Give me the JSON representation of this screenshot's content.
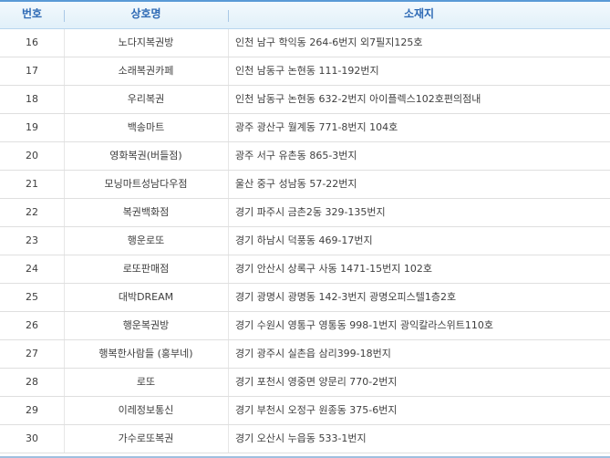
{
  "header": {
    "col_no": "번호",
    "col_name": "상호명",
    "col_addr": "소재지"
  },
  "rows": [
    {
      "no": "16",
      "name": "노다지복권방",
      "addr": "인천 남구 학익동 264-6번지 외7필지125호"
    },
    {
      "no": "17",
      "name": "소래복권카페",
      "addr": "인천 남동구 논현동 111-192번지"
    },
    {
      "no": "18",
      "name": "우리복권",
      "addr": "인천 남동구 논현동 632-2번지 아이플렉스102호편의점내"
    },
    {
      "no": "19",
      "name": "백송마트",
      "addr": "광주 광산구 월계동 771-8번지 104호"
    },
    {
      "no": "20",
      "name": "영화복권(버들점)",
      "addr": "광주 서구 유촌동 865-3번지"
    },
    {
      "no": "21",
      "name": "모닝마트성남다우점",
      "addr": "울산 중구 성남동 57-22번지"
    },
    {
      "no": "22",
      "name": "복권백화점",
      "addr": "경기 파주시 금촌2동 329-135번지"
    },
    {
      "no": "23",
      "name": "행운로또",
      "addr": "경기 하남시 덕풍동 469-17번지"
    },
    {
      "no": "24",
      "name": "로또판매점",
      "addr": "경기 안산시 상록구 사동 1471-15번지 102호"
    },
    {
      "no": "25",
      "name": "대박DREAM",
      "addr": "경기 광명시 광명동 142-3번지 광명오피스텔1층2호"
    },
    {
      "no": "26",
      "name": "행운복권방",
      "addr": "경기 수원시 영통구 영통동 998-1번지 광익칼라스위트110호"
    },
    {
      "no": "27",
      "name": "행복한사람들 (홍부네)",
      "addr": "경기 광주시 실촌읍 삼리399-18번지"
    },
    {
      "no": "28",
      "name": "로또",
      "addr": "경기 포천시 영중면 양문리 770-2번지"
    },
    {
      "no": "29",
      "name": "이레정보통신",
      "addr": "경기 부천시 오정구 원종동 375-6번지"
    },
    {
      "no": "30",
      "name": "가수로또복권",
      "addr": "경기 오산시 누읍동 533-1번지"
    }
  ]
}
